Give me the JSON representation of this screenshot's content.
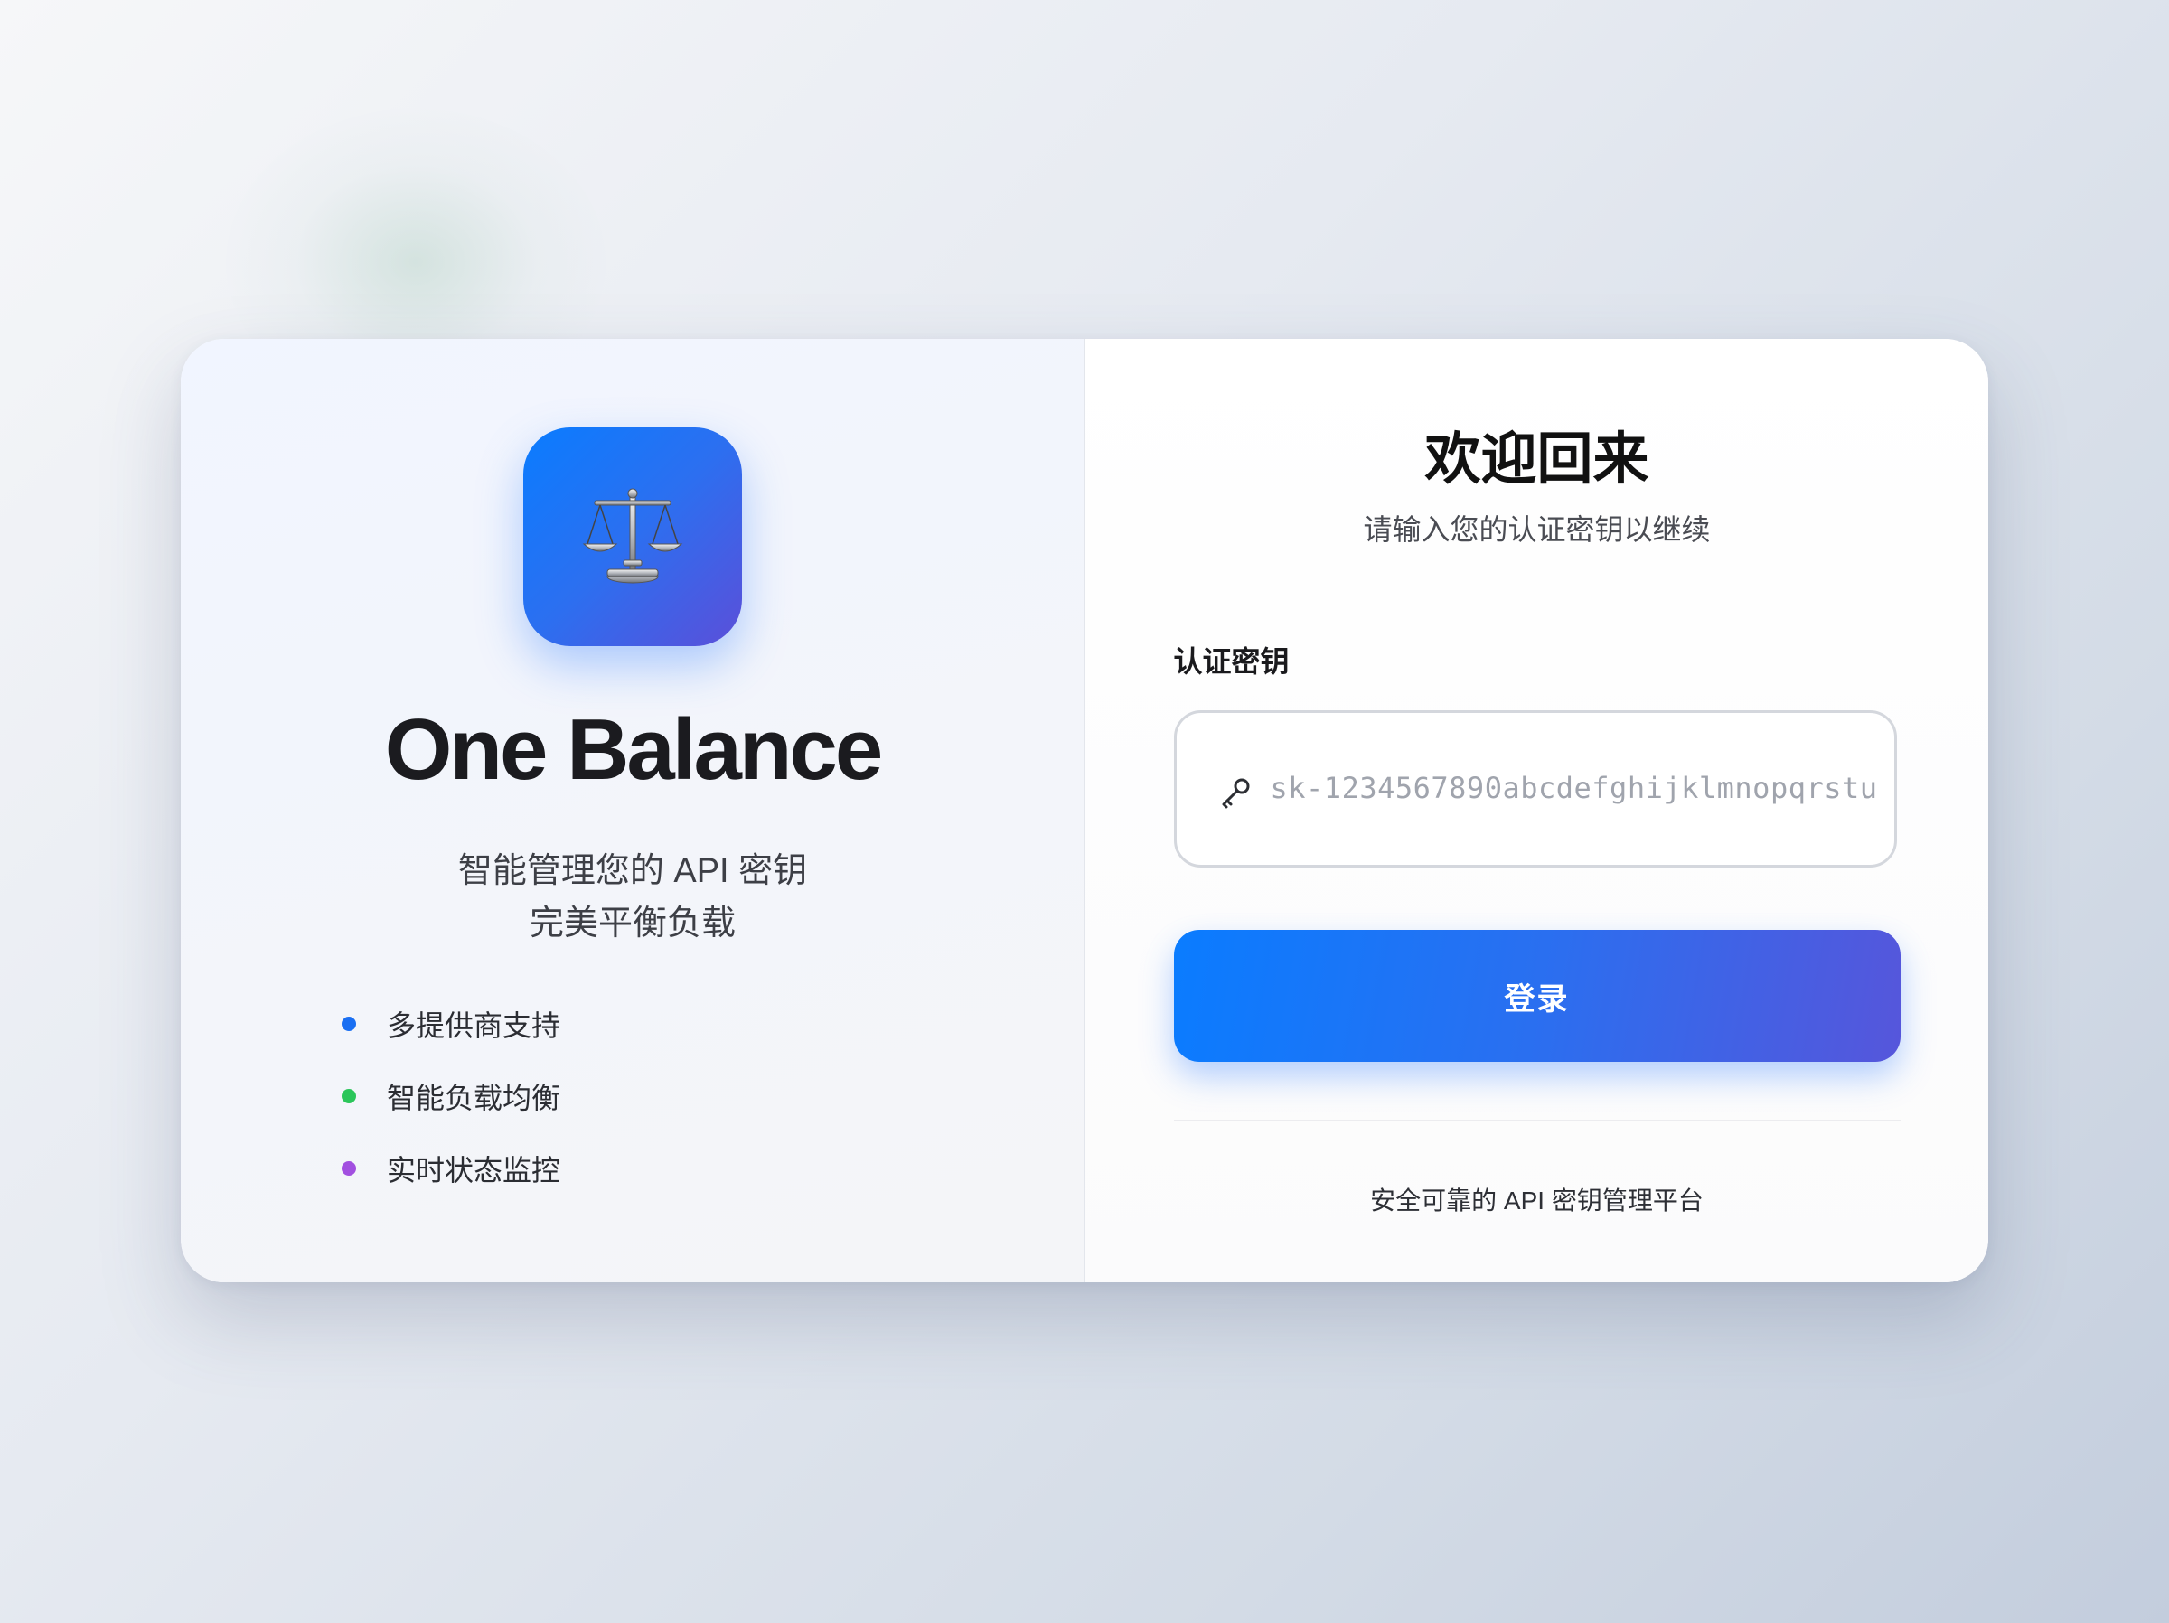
{
  "brand": {
    "logo_icon": "balance-scale-icon",
    "name": "One Balance",
    "tagline_line1": "智能管理您的 API 密钥",
    "tagline_line2": "完美平衡负载"
  },
  "features": [
    {
      "label": "多提供商支持",
      "color": "#1a6ff2"
    },
    {
      "label": "智能负载均衡",
      "color": "#2bc65a"
    },
    {
      "label": "实时状态监控",
      "color": "#a24fe0"
    }
  ],
  "login": {
    "title": "欢迎回来",
    "subtitle": "请输入您的认证密钥以继续",
    "field_label": "认证密钥",
    "field_icon": "key-icon",
    "field_value": "sk-1234567890abcdefghijklmnopqrstu",
    "submit_label": "登录",
    "footer": "安全可靠的 API 密钥管理平台"
  },
  "colors": {
    "accent_start": "#0a7cff",
    "accent_end": "#5656db"
  }
}
